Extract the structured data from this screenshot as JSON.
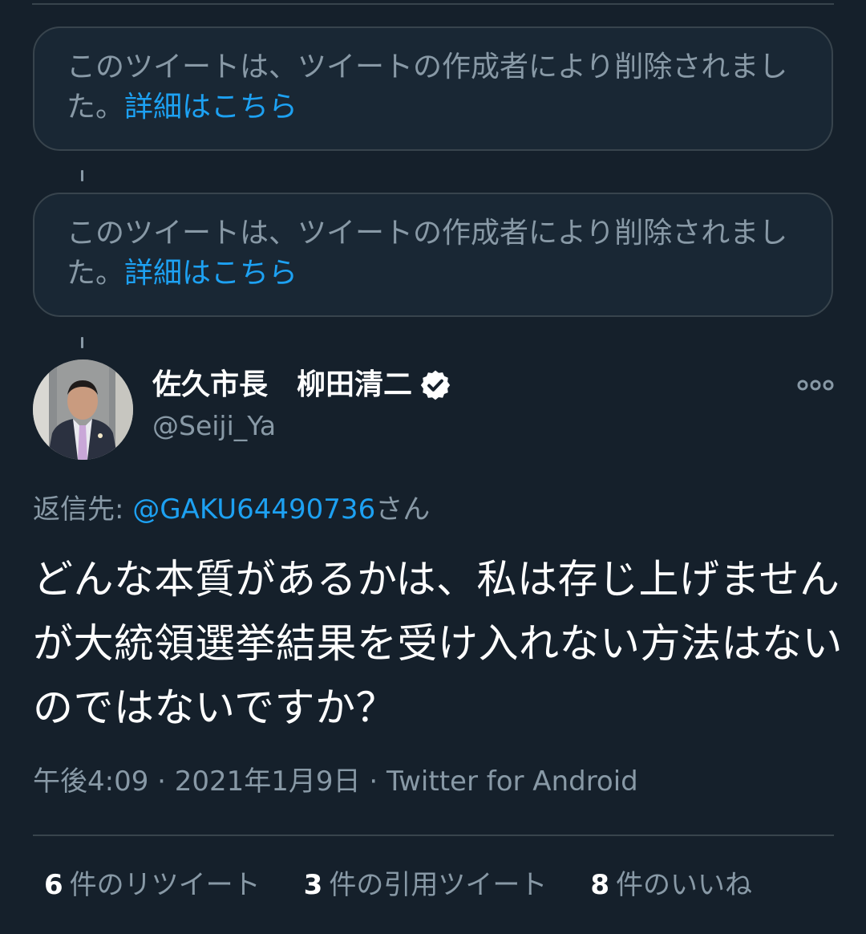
{
  "thread": {
    "deleted_tweets": [
      {
        "message": "このツイートは、ツイートの作成者により削除されました。",
        "link": "詳細はこちら"
      },
      {
        "message": "このツイートは、ツイートの作成者により削除されました。",
        "link": "詳細はこちら"
      }
    ]
  },
  "tweet": {
    "author": {
      "name": "佐久市長　柳田清二",
      "handle": "@Seiji_Ya",
      "verified": true
    },
    "reply_to": {
      "prefix": "返信先: ",
      "mention": "@GAKU64490736",
      "suffix": "さん"
    },
    "text": "どんな本質があるかは、私は存じ上げませんが大統領選挙結果を受け入れない方法はないのではないですか？",
    "meta": "午後4:09 · 2021年1月9日 · Twitter for Android",
    "stats": {
      "retweets_count": "6",
      "retweets_label": "件のリツイート",
      "quotes_count": "3",
      "quotes_label": "件の引用ツイート",
      "likes_count": "8",
      "likes_label": "件のいいね"
    }
  },
  "icons": {
    "verified": "verified-badge-icon",
    "more": "more-options-icon"
  },
  "colors": {
    "background": "#15202b",
    "card_background": "#192734",
    "border": "#38444d",
    "secondary_text": "#8899a6",
    "link": "#1da1f2"
  }
}
